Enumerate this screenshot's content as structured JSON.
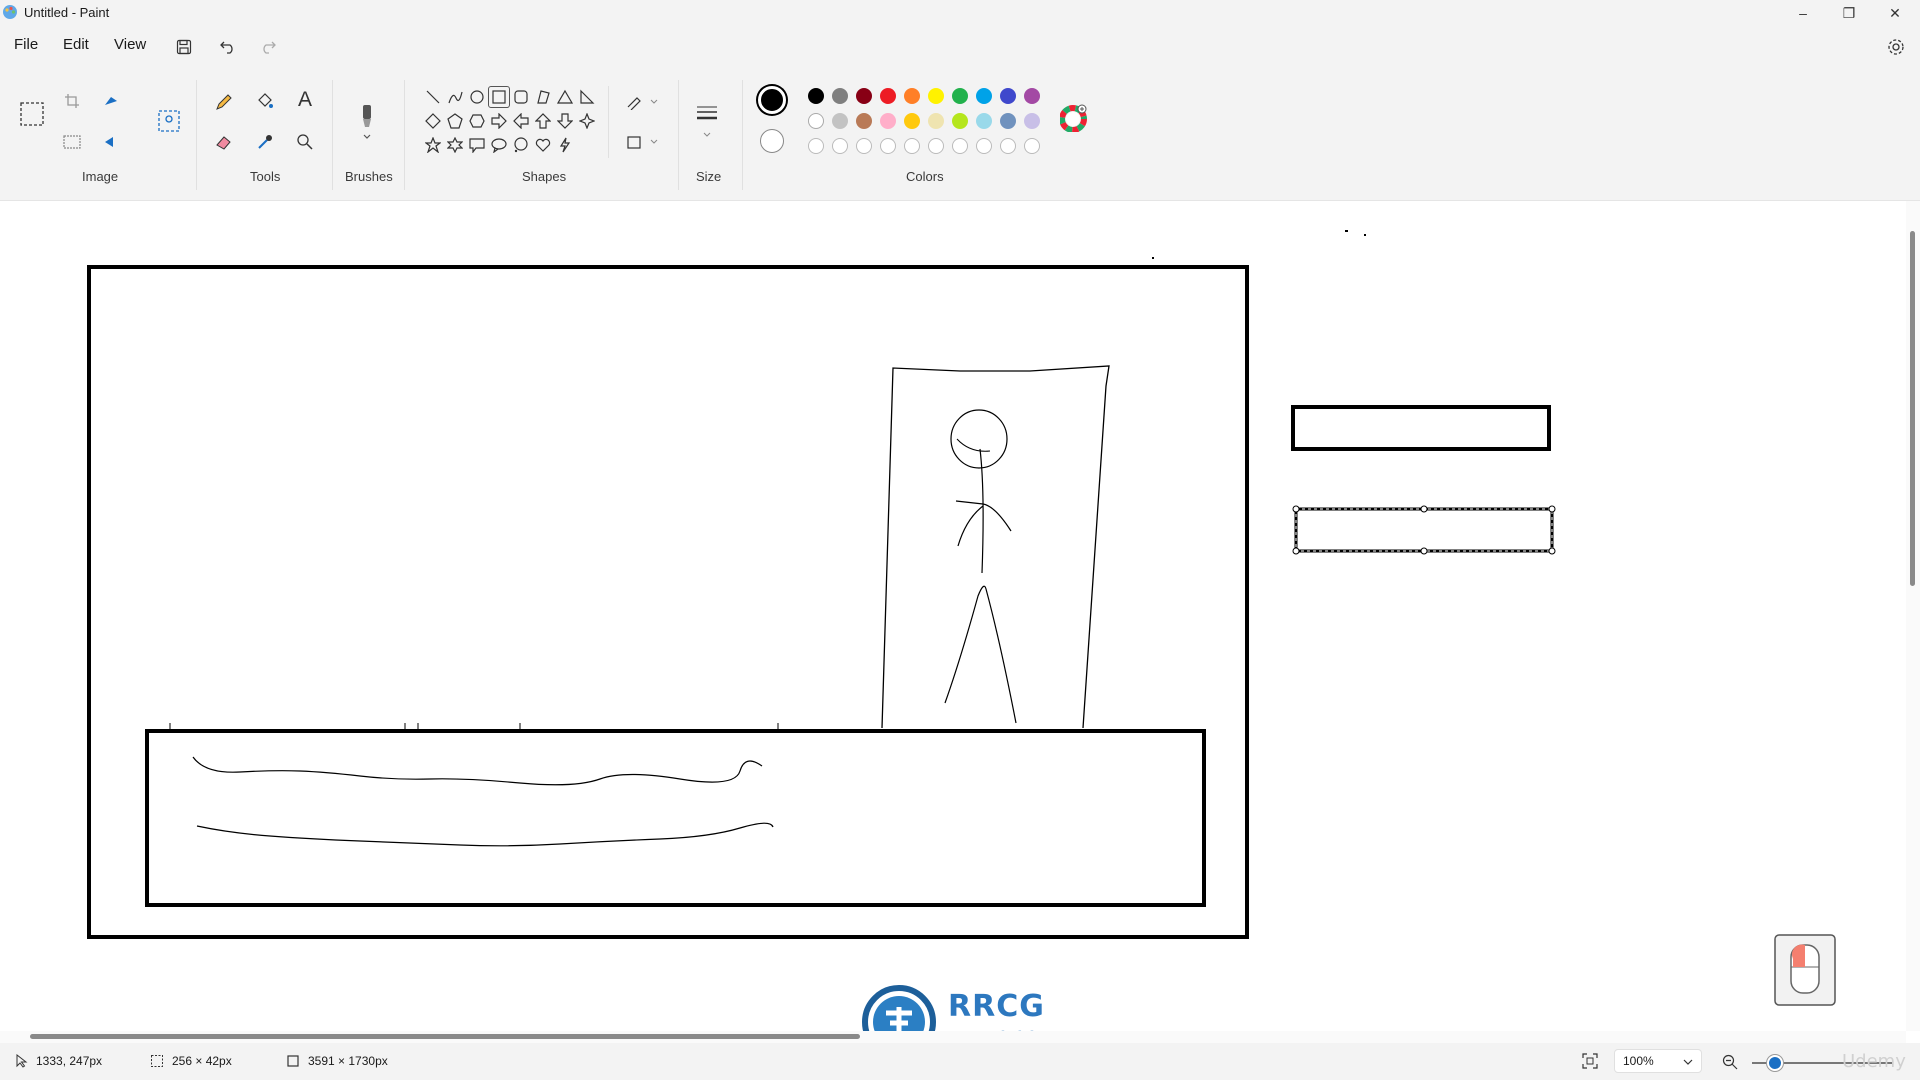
{
  "window": {
    "title": "Untitled - Paint",
    "minimize_glyph": "–",
    "maximize_glyph": "❐",
    "close_glyph": "✕"
  },
  "menu": {
    "file": "File",
    "edit": "Edit",
    "view": "View"
  },
  "ribbon": {
    "groups": {
      "image": "Image",
      "tools": "Tools",
      "brushes": "Brushes",
      "shapes": "Shapes",
      "size": "Size",
      "colors": "Colors"
    },
    "text_tool_glyph": "A"
  },
  "colors": {
    "primary": "#000000",
    "secondary": "#ffffff",
    "palette_row1": [
      "#000000",
      "#7f7f7f",
      "#880015",
      "#ed1c24",
      "#ff7f27",
      "#fff200",
      "#22b14c",
      "#00a2e8",
      "#3f48cc",
      "#a349a4"
    ],
    "palette_row2": [
      "#ffffff",
      "#c3c3c3",
      "#b97a57",
      "#ffaec9",
      "#ffc90e",
      "#efe4b0",
      "#b5e61d",
      "#99d9ea",
      "#7092be",
      "#c8bfe7"
    ],
    "accent": "#1a6fc4"
  },
  "status": {
    "cursor_position": "1333, 247px",
    "selection_size": "256 × 42px",
    "canvas_size": "3591 × 1730px",
    "zoom": "100%"
  },
  "overlays": {
    "logo_text": "RRCG",
    "logo_subtext": "人人素材",
    "watermark": "Udemy"
  }
}
